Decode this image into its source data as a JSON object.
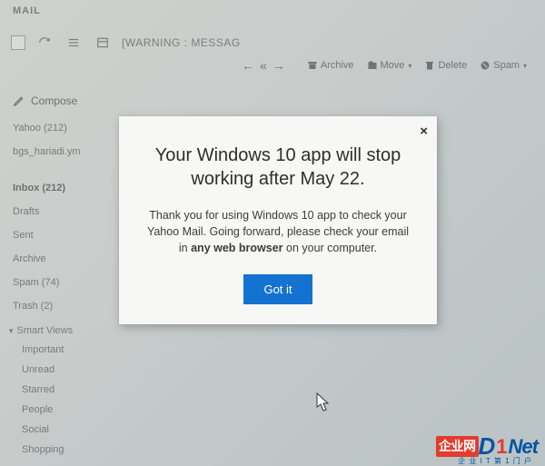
{
  "header": {
    "app_label": "MAIL"
  },
  "toolrow": {
    "warning_text": "[WARNING : MESSAG"
  },
  "actionbar": {
    "archive": "Archive",
    "move": "Move",
    "delete": "Delete",
    "spam": "Spam"
  },
  "compose": {
    "label": "Compose"
  },
  "accounts": [
    {
      "label": "Yahoo (212)"
    },
    {
      "label": "bgs_hariadi.ym"
    }
  ],
  "folders": [
    {
      "label": "Inbox (212)",
      "bold": true
    },
    {
      "label": "Drafts"
    },
    {
      "label": "Sent"
    },
    {
      "label": "Archive"
    },
    {
      "label": "Spam (74)"
    },
    {
      "label": "Trash (2)"
    }
  ],
  "smartviews": {
    "heading": "Smart Views",
    "items": [
      {
        "label": "Important"
      },
      {
        "label": "Unread"
      },
      {
        "label": "Starred"
      },
      {
        "label": "People"
      },
      {
        "label": "Social"
      },
      {
        "label": "Shopping"
      }
    ]
  },
  "modal": {
    "title": "Your Windows 10 app will stop working after May 22.",
    "body_pre": "Thank you for using Windows 10 app to check your Yahoo Mail. Going forward, please check your email in ",
    "body_bold": "any web browser",
    "body_post": " on your computer.",
    "button": "Got it",
    "close": "×"
  },
  "watermark": {
    "box": "企业网",
    "d": "D",
    "one": "1",
    "net": "Net",
    "sub": "企 业 I T 第 1 门 户"
  }
}
